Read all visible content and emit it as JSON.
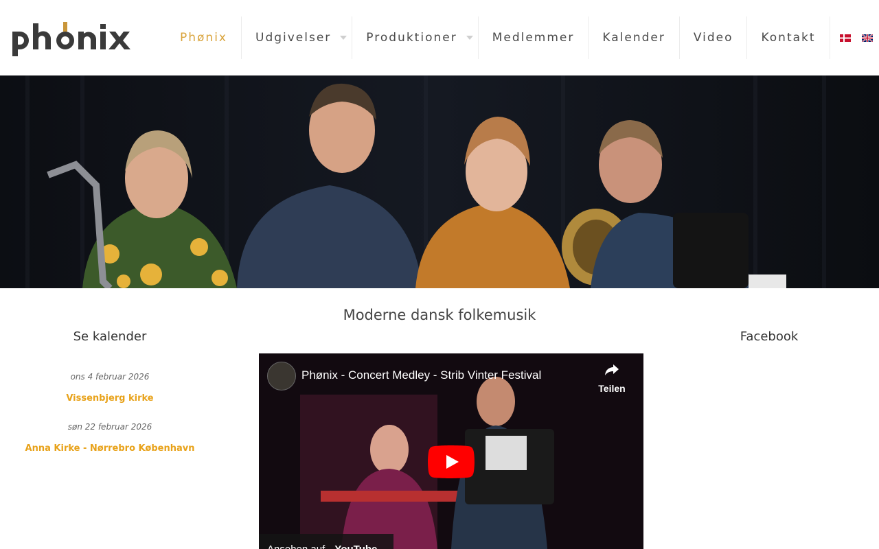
{
  "site": {
    "logo_text": "phønix",
    "brand_color": "#d9a33a",
    "link_color": "#e8a21a"
  },
  "nav": {
    "items": [
      {
        "label": "Phønix",
        "active": true,
        "has_submenu": false
      },
      {
        "label": "Udgivelser",
        "active": false,
        "has_submenu": true
      },
      {
        "label": "Produktioner",
        "active": false,
        "has_submenu": true
      },
      {
        "label": "Medlemmer",
        "active": false,
        "has_submenu": false
      },
      {
        "label": "Kalender",
        "active": false,
        "has_submenu": false
      },
      {
        "label": "Video",
        "active": false,
        "has_submenu": false
      },
      {
        "label": "Kontakt",
        "active": false,
        "has_submenu": false
      }
    ],
    "languages": [
      "danish-flag-icon",
      "english-flag-icon"
    ]
  },
  "main": {
    "heading": "Moderne dansk folkemusik"
  },
  "calendar": {
    "title": "Se kalender",
    "events": [
      {
        "date": "ons 4 februar 2026",
        "venue": "Vissenbjerg kirke"
      },
      {
        "date": "søn 22 februar 2026",
        "venue": "Anna Kirke - Nørrebro København"
      }
    ]
  },
  "facebook": {
    "title": "Facebook"
  },
  "video": {
    "title": "Phønix - Concert Medley - Strib Vinter Festival",
    "share_label": "Teilen",
    "watch_label": "Ansehen auf",
    "platform": "YouTube"
  }
}
